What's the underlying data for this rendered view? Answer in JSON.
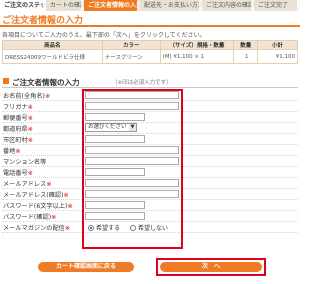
{
  "steps": {
    "label": "ご注文のステップ",
    "items": [
      "カートの確認",
      "ご注文者情報の入力",
      "配送先・お支払い方法の選択",
      "ご注文内容の確認",
      "ご注文完了"
    ]
  },
  "page": {
    "title": "ご注文者情報の入力",
    "intro": "各項目についてご入力のうえ、最下部の「次へ」をクリックしてください。"
  },
  "product_table": {
    "headers": [
      "商品名",
      "カラー",
      "（サイズ）規格・数量",
      "数量",
      "小計"
    ],
    "row": [
      "DRESS24009ワールドビラ仕様",
      "ナースグリーン",
      "(M) ¥1,100 × 1",
      "1",
      "¥1,100"
    ]
  },
  "form": {
    "title": "ご注文者情報の入力",
    "note": "（※印は必須入力です）",
    "fields": [
      {
        "label": "お名前(全角名)",
        "req": "※"
      },
      {
        "label": "フリガナ",
        "req": "※"
      },
      {
        "label": "郵便番号",
        "req": "※"
      },
      {
        "label": "都道府県",
        "req": "※"
      },
      {
        "label": "市区町村",
        "req": "※"
      },
      {
        "label": "番地",
        "req": "※"
      },
      {
        "label": "マンション名等",
        "req": ""
      },
      {
        "label": "電話番号",
        "req": "※"
      },
      {
        "label": "メールアドレス",
        "req": "※"
      },
      {
        "label": "メールアドレス(確認)",
        "req": "※"
      },
      {
        "label": "パスワード(6文字以上)",
        "req": "※"
      },
      {
        "label": "パスワード(確認)",
        "req": "※"
      },
      {
        "label": "メールマガジンの配信",
        "req": "※"
      }
    ],
    "prefecture_select": "お選びください",
    "newsletter": {
      "opt_in": "希望する",
      "opt_out": "希望しない"
    }
  },
  "buttons": {
    "back": "カート確認画面に戻る",
    "next": "次　へ"
  },
  "colors": {
    "accent": "#ef7a22",
    "highlight": "#e0001b"
  }
}
